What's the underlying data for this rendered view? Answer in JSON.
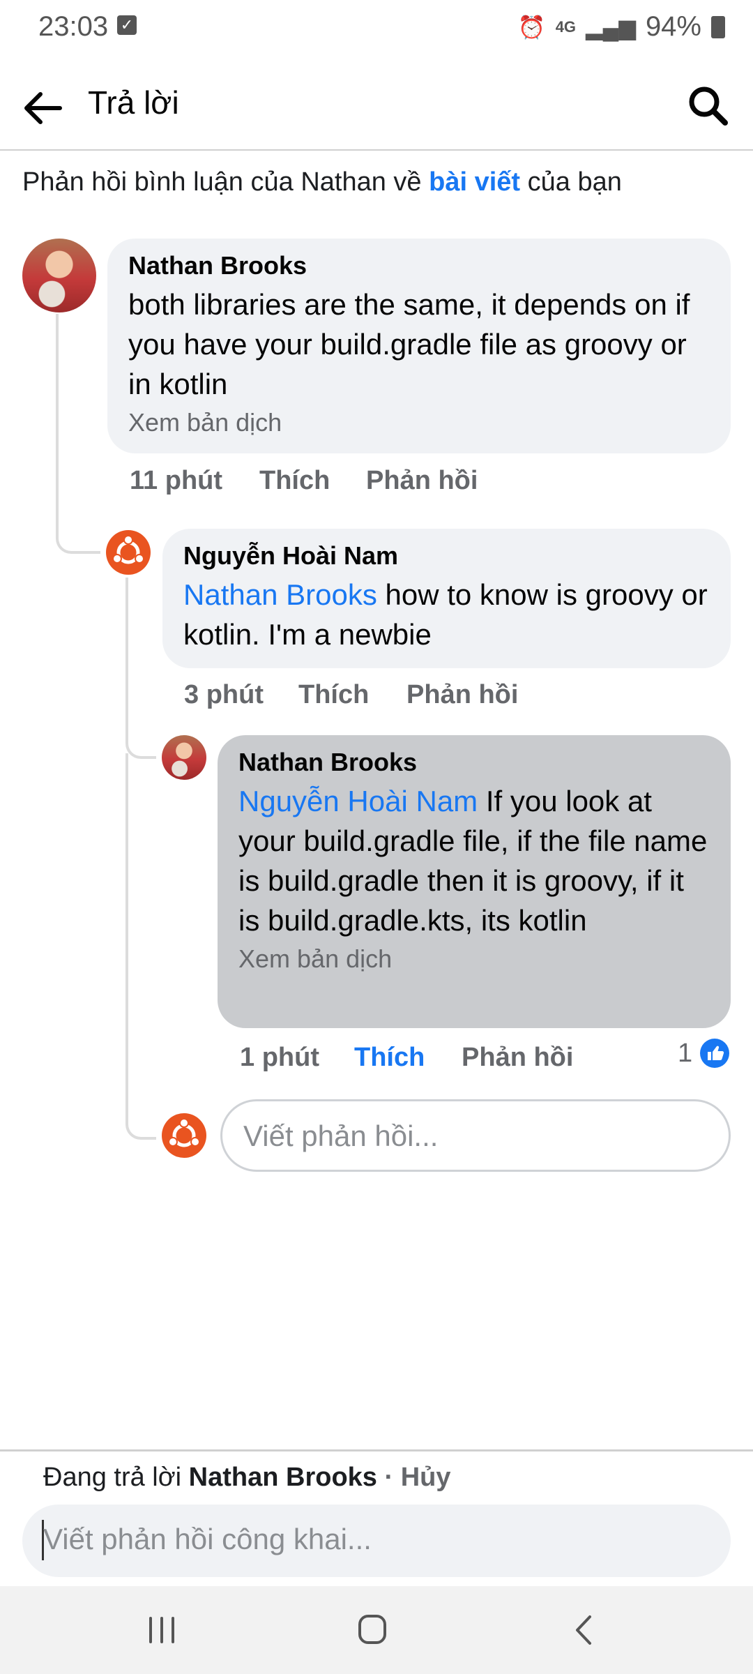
{
  "status": {
    "time": "23:03",
    "battery": "94%",
    "network": "4G"
  },
  "header": {
    "title": "Trả lời"
  },
  "context": {
    "prefix": "Phản hồi bình luận của Nathan về ",
    "link": "bài viết",
    "suffix": " của bạn"
  },
  "comments": [
    {
      "author": "Nathan Brooks",
      "text": "both libraries are the same, it depends on if you have your build.gradle file as groovy or in kotlin",
      "translate": "Xem bản dịch",
      "time": "11 phút",
      "like": "Thích",
      "reply": "Phản hồi"
    },
    {
      "author": "Nguyễn Hoài Nam",
      "mention": "Nathan Brooks",
      "text": " how to know is groovy or kotlin. I'm a newbie",
      "time": "3 phút",
      "like": "Thích",
      "reply": "Phản hồi"
    },
    {
      "author": "Nathan Brooks",
      "mention": "Nguyễn Hoài Nam",
      "text": " If you look at your build.gradle file, if the file name is build.gradle then it is groovy, if it is build.gradle.kts, its kotlin",
      "translate": "Xem bản dịch",
      "time": "1 phút",
      "like": "Thích",
      "reply": "Phản hồi",
      "reaction_count": "1"
    }
  ],
  "reply_field": {
    "placeholder": "Viết phản hồi..."
  },
  "composer": {
    "prefix": "Đang trả lời ",
    "name": "Nathan Brooks",
    "separator": " · ",
    "cancel": "Hủy",
    "placeholder": "Viết phản hồi công khai..."
  },
  "colors": {
    "accent": "#1877f2",
    "bubble": "#f0f2f5",
    "bubble_selected": "#c9cbce",
    "ubuntu": "#e95420"
  }
}
